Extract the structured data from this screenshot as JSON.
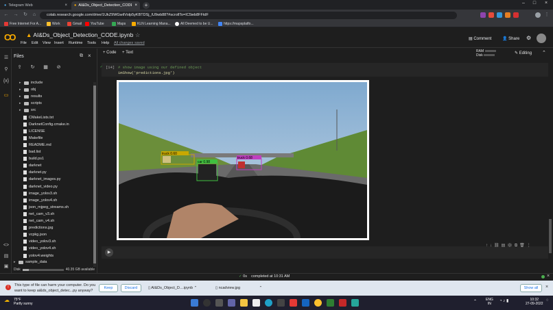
{
  "browser": {
    "tabs": [
      {
        "title": "Telegram Web"
      },
      {
        "title": "AI&Ds_Object_Detection_CODE.i"
      }
    ],
    "url": "colab.research.google.com/drive/1UkZ9WGwiIVolp5yKBTDSj_IU9wb88?#scrollTo=IC5ieb8FFtdF",
    "bookmarks": [
      "Free Internet For A...",
      "Work",
      "Gmail",
      "YouTube",
      "Maps",
      "KLN Learning Mana...",
      "All Deemed to be U...",
      "https://mapsplatfo..."
    ]
  },
  "colab": {
    "notebook_title": "AI&Ds_Object_Detection_CODE.ipynb",
    "menus": [
      "File",
      "Edit",
      "View",
      "Insert",
      "Runtime",
      "Tools",
      "Help"
    ],
    "saved_status": "All changes saved",
    "comment": "Comment",
    "share": "Share",
    "ram": "RAM",
    "disk": "Disk",
    "editing": "Editing",
    "add_code": "+ Code",
    "add_text": "+ Text"
  },
  "files": {
    "header": "Files",
    "items": [
      {
        "name": "include",
        "type": "folder"
      },
      {
        "name": "obj",
        "type": "folder"
      },
      {
        "name": "results",
        "type": "folder"
      },
      {
        "name": "scripts",
        "type": "folder"
      },
      {
        "name": "src",
        "type": "folder"
      },
      {
        "name": "CMakeLists.txt",
        "type": "file"
      },
      {
        "name": "DarknetConfig.cmake.in",
        "type": "file"
      },
      {
        "name": "LICENSE",
        "type": "file"
      },
      {
        "name": "Makefile",
        "type": "file"
      },
      {
        "name": "README.md",
        "type": "file"
      },
      {
        "name": "bad.list",
        "type": "file"
      },
      {
        "name": "build.ps1",
        "type": "file"
      },
      {
        "name": "darknet",
        "type": "file"
      },
      {
        "name": "darknet.py",
        "type": "file"
      },
      {
        "name": "darknet_images.py",
        "type": "file"
      },
      {
        "name": "darknet_video.py",
        "type": "file"
      },
      {
        "name": "image_yolov3.sh",
        "type": "file"
      },
      {
        "name": "image_yolov4.sh",
        "type": "file"
      },
      {
        "name": "json_mjpeg_streams.sh",
        "type": "file"
      },
      {
        "name": "net_cam_v3.sh",
        "type": "file"
      },
      {
        "name": "net_cam_v4.sh",
        "type": "file"
      },
      {
        "name": "predictions.jpg",
        "type": "file"
      },
      {
        "name": "vcpkg.json",
        "type": "file"
      },
      {
        "name": "video_yolov3.sh",
        "type": "file"
      },
      {
        "name": "video_yolov4.sh",
        "type": "file"
      },
      {
        "name": "yolov4.weights",
        "type": "file"
      },
      {
        "name": "sample_data",
        "type": "folder"
      }
    ],
    "disk_label": "Disk",
    "disk_available": "40.35 GB available"
  },
  "cell": {
    "exec_count": "[14]",
    "comment": "# show image using our defined object",
    "code": "imShow('predictions.jpg')"
  },
  "detections": [
    {
      "label": "truck 0.60",
      "color": "#c8a800"
    },
    {
      "label": "car 0.98",
      "color": "#40c040"
    },
    {
      "label": "truck 0.68",
      "color": "#c040c0"
    }
  ],
  "status": {
    "exec_time": "0s",
    "completed": "completed at 10:31 AM"
  },
  "download": {
    "message": "This type of file can harm your computer. Do you want to keep ai&ds_object_detec...py anyway?",
    "keep": "Keep",
    "discard": "Discard",
    "file1": "AI&Ds_Object_D....ipynb",
    "file2": "ncadview.jpg",
    "show_all": "Show all"
  },
  "taskbar": {
    "temp": "75°F",
    "weather": "Partly sunny",
    "lang": "ENG",
    "region": "IN",
    "time": "10:32",
    "date": "27-09-2022"
  }
}
